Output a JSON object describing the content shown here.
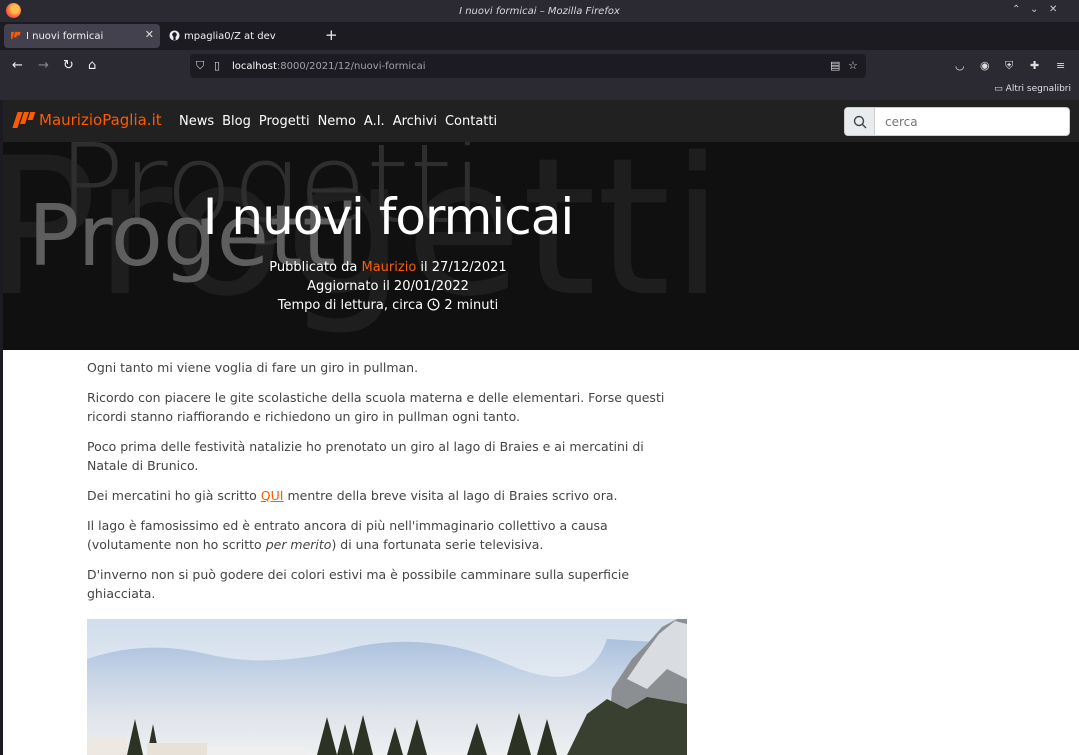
{
  "browser": {
    "window_title": "I nuovi formicai – Mozilla Firefox",
    "tabs": [
      {
        "label": "I nuovi formicai",
        "active": true
      },
      {
        "label": "mpaglia0/Z at dev",
        "active": false
      }
    ],
    "url_host": "localhost",
    "url_rest": ":8000/2021/12/nuovi-formicai",
    "bookmarks_label": "Altri segnalibri"
  },
  "site": {
    "logo_text": "MaurizioPaglia.it",
    "menu": [
      "News",
      "Blog",
      "Progetti",
      "Nemo",
      "A.I.",
      "Archivi",
      "Contatti"
    ],
    "search_placeholder": "cerca",
    "brand_color": "#ff5a00"
  },
  "hero": {
    "bg_word": "Progetti",
    "title": "I nuovi formicai",
    "published_prefix": "Pubblicato da",
    "author": "Maurizio",
    "published_suffix": "il 27/12/2021",
    "updated": "Aggiornato il 20/01/2022",
    "reading_prefix": "Tempo di lettura, circa",
    "reading_time": "2 minuti"
  },
  "article": {
    "p1": "Ogni tanto mi viene voglia di fare un giro in pullman.",
    "p2": "Ricordo con piacere le gite scolastiche della scuola materna e delle elementari. Forse questi ricordi stanno riaffiorando e richiedono un giro in pullman ogni tanto.",
    "p3": "Poco prima delle festività natalizie ho prenotato un giro al lago di Braies e ai mercatini di Natale di Brunico.",
    "p4_pre": "Dei mercatini ho già scritto",
    "p4_link": "QUI",
    "p4_post": "mentre della breve visita al lago di Braies scrivo ora.",
    "p5_pre": "Il lago è famosissimo ed è entrato ancora di più nell'immaginario collettivo a causa (volutamente non ho scritto",
    "p5_em": "per merito",
    "p5_post": ") di una fortunata serie televisiva.",
    "p6": "D'inverno non si può godere dei colori estivi ma è possibile camminare sulla superficie ghiacciata."
  }
}
